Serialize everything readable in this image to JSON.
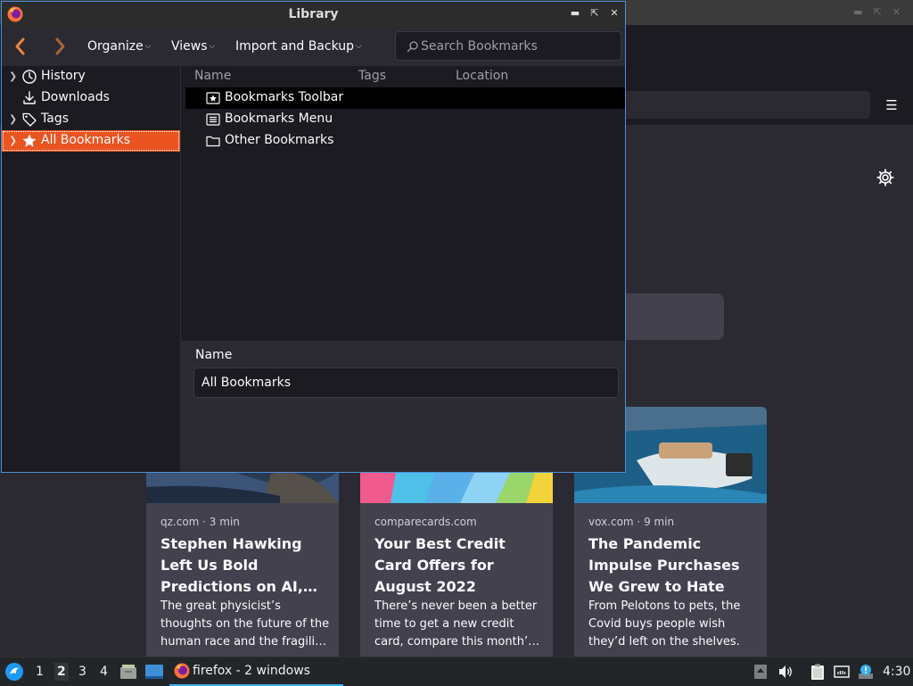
{
  "background": {
    "stories": [
      {
        "source": "qz.com · 3 min",
        "title": "Stephen Hawking Left Us Bold Predictions on AI, Superhumans, and More",
        "excerpt": "The great physicist’s thoughts on the future of the human race and the fragility of the planet."
      },
      {
        "source": "comparecards.com",
        "title": "Your Best Credit Card Offers for August 2022",
        "excerpt": "There’s never been a better time to get a new credit card, compare this month’s offers."
      },
      {
        "source": "vox.com · 9 min",
        "title": "The Pandemic Impulse Purchases We Grew to Hate",
        "excerpt": "From Pelotons to pets, the Covid buys people wish they’d left on the shelves."
      }
    ]
  },
  "library": {
    "title": "Library",
    "toolbar": {
      "organize": "Organize",
      "views": "Views",
      "import_backup": "Import and Backup",
      "search_placeholder": "Search Bookmarks"
    },
    "sidebar": {
      "items": [
        {
          "label": "History",
          "icon": "clock-icon",
          "expandable": true
        },
        {
          "label": "Downloads",
          "icon": "download-icon",
          "expandable": false
        },
        {
          "label": "Tags",
          "icon": "tag-icon",
          "expandable": true
        },
        {
          "label": "All Bookmarks",
          "icon": "star-icon",
          "expandable": true,
          "selected": true
        }
      ]
    },
    "columns": [
      "Name",
      "Tags",
      "Location"
    ],
    "rows": [
      {
        "label": "Bookmarks Toolbar",
        "icon": "bookmarks-toolbar-icon",
        "selected": true
      },
      {
        "label": "Bookmarks Menu",
        "icon": "bookmarks-menu-icon",
        "selected": false
      },
      {
        "label": "Other Bookmarks",
        "icon": "folder-icon",
        "selected": false
      }
    ],
    "details": {
      "name_label": "Name",
      "name_value": "All Bookmarks"
    }
  },
  "taskbar": {
    "workspaces": [
      "1",
      "2",
      "3",
      "4"
    ],
    "active_workspace": "2",
    "task_label": "firefox - 2 windows",
    "clock": "4:30"
  },
  "colors": {
    "accent": "#e95420",
    "selection_focus": "#4a90d9",
    "taskbar_active": "#3daee9"
  }
}
